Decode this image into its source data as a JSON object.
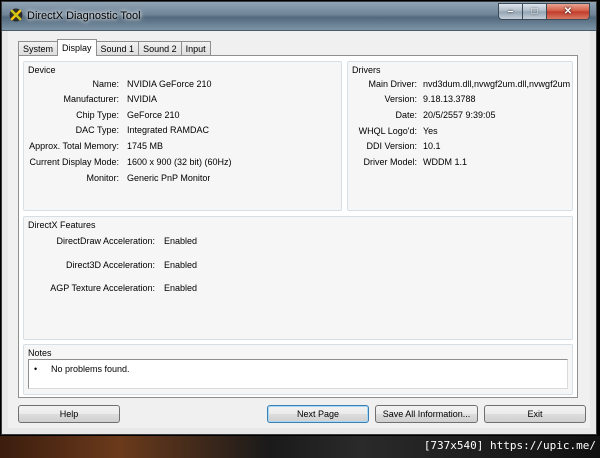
{
  "window": {
    "title": "DirectX Diagnostic Tool"
  },
  "caption": {
    "minimize": "–",
    "maximize": "□",
    "close": "✕"
  },
  "tabs": [
    {
      "label": "System",
      "active": false
    },
    {
      "label": "Display",
      "active": true
    },
    {
      "label": "Sound 1",
      "active": false
    },
    {
      "label": "Sound 2",
      "active": false
    },
    {
      "label": "Input",
      "active": false
    }
  ],
  "device": {
    "title": "Device",
    "rows": [
      {
        "label": "Name:",
        "value": "NVIDIA GeForce 210"
      },
      {
        "label": "Manufacturer:",
        "value": "NVIDIA"
      },
      {
        "label": "Chip Type:",
        "value": "GeForce 210"
      },
      {
        "label": "DAC Type:",
        "value": "Integrated RAMDAC"
      },
      {
        "label": "Approx. Total Memory:",
        "value": "1745 MB"
      },
      {
        "label": "Current Display Mode:",
        "value": "1600 x 900 (32 bit) (60Hz)"
      },
      {
        "label": "Monitor:",
        "value": "Generic PnP Monitor"
      }
    ]
  },
  "drivers": {
    "title": "Drivers",
    "rows": [
      {
        "label": "Main Driver:",
        "value": "nvd3dum.dll,nvwgf2um.dll,nvwgf2um"
      },
      {
        "label": "Version:",
        "value": "9.18.13.3788"
      },
      {
        "label": "Date:",
        "value": "20/5/2557 9:39:05"
      },
      {
        "label": "WHQL Logo'd:",
        "value": "Yes"
      },
      {
        "label": "DDI Version:",
        "value": "10.1"
      },
      {
        "label": "Driver Model:",
        "value": "WDDM 1.1"
      }
    ]
  },
  "features": {
    "title": "DirectX Features",
    "rows": [
      {
        "label": "DirectDraw Acceleration:",
        "value": "Enabled"
      },
      {
        "label": "Direct3D Acceleration:",
        "value": "Enabled"
      },
      {
        "label": "AGP Texture Acceleration:",
        "value": "Enabled"
      }
    ]
  },
  "notes": {
    "title": "Notes",
    "bullet": "•",
    "text": "No problems found."
  },
  "buttons": {
    "help": "Help",
    "next_page": "Next Page",
    "save_all": "Save All Information...",
    "exit": "Exit"
  },
  "watermark": "[737x540] https://upic.me/"
}
